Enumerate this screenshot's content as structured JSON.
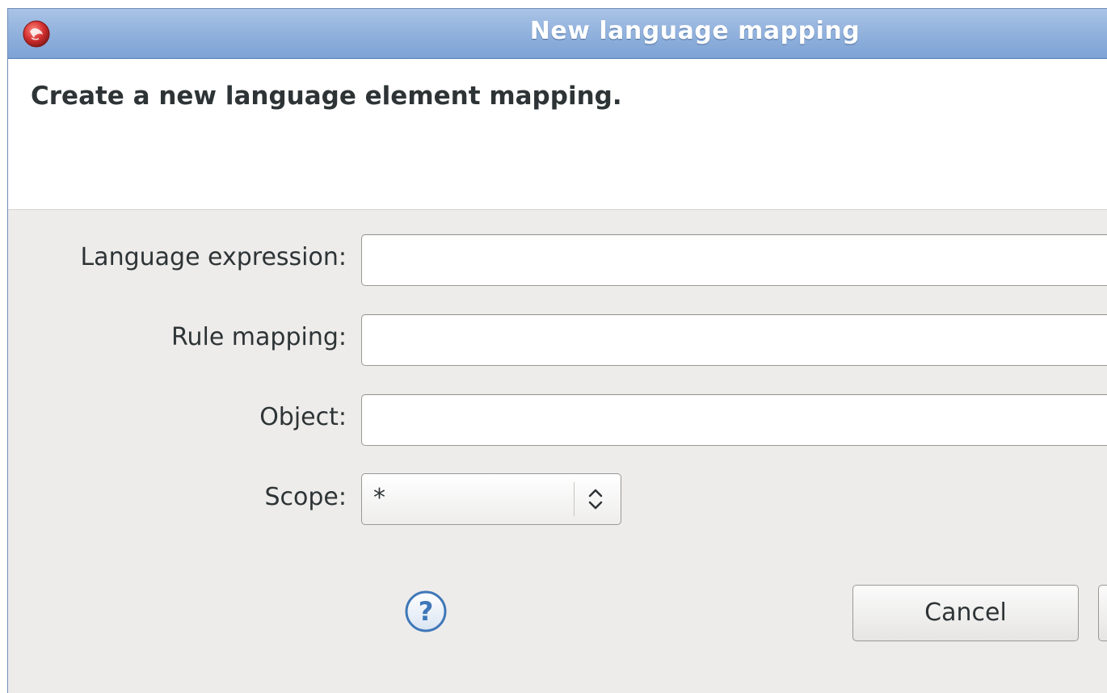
{
  "window": {
    "title": "New language mapping"
  },
  "banner": {
    "message": "Create a new language element mapping."
  },
  "form": {
    "language_expression_label": "Language expression:",
    "language_expression_value": "",
    "rule_mapping_label": "Rule mapping:",
    "rule_mapping_value": "",
    "object_label": "Object:",
    "object_value": "",
    "scope_label": "Scope:",
    "scope_value": "*"
  },
  "buttons": {
    "cancel_label": "Cancel"
  },
  "icons": {
    "app": "eclipse-red-hat-icon",
    "help": "help-icon",
    "combo_arrow": "up-down-chevron-icon"
  },
  "colors": {
    "titlebar": "#8fb0dc",
    "dialog_background": "#edeceb",
    "help_icon": "#3f77b8"
  }
}
